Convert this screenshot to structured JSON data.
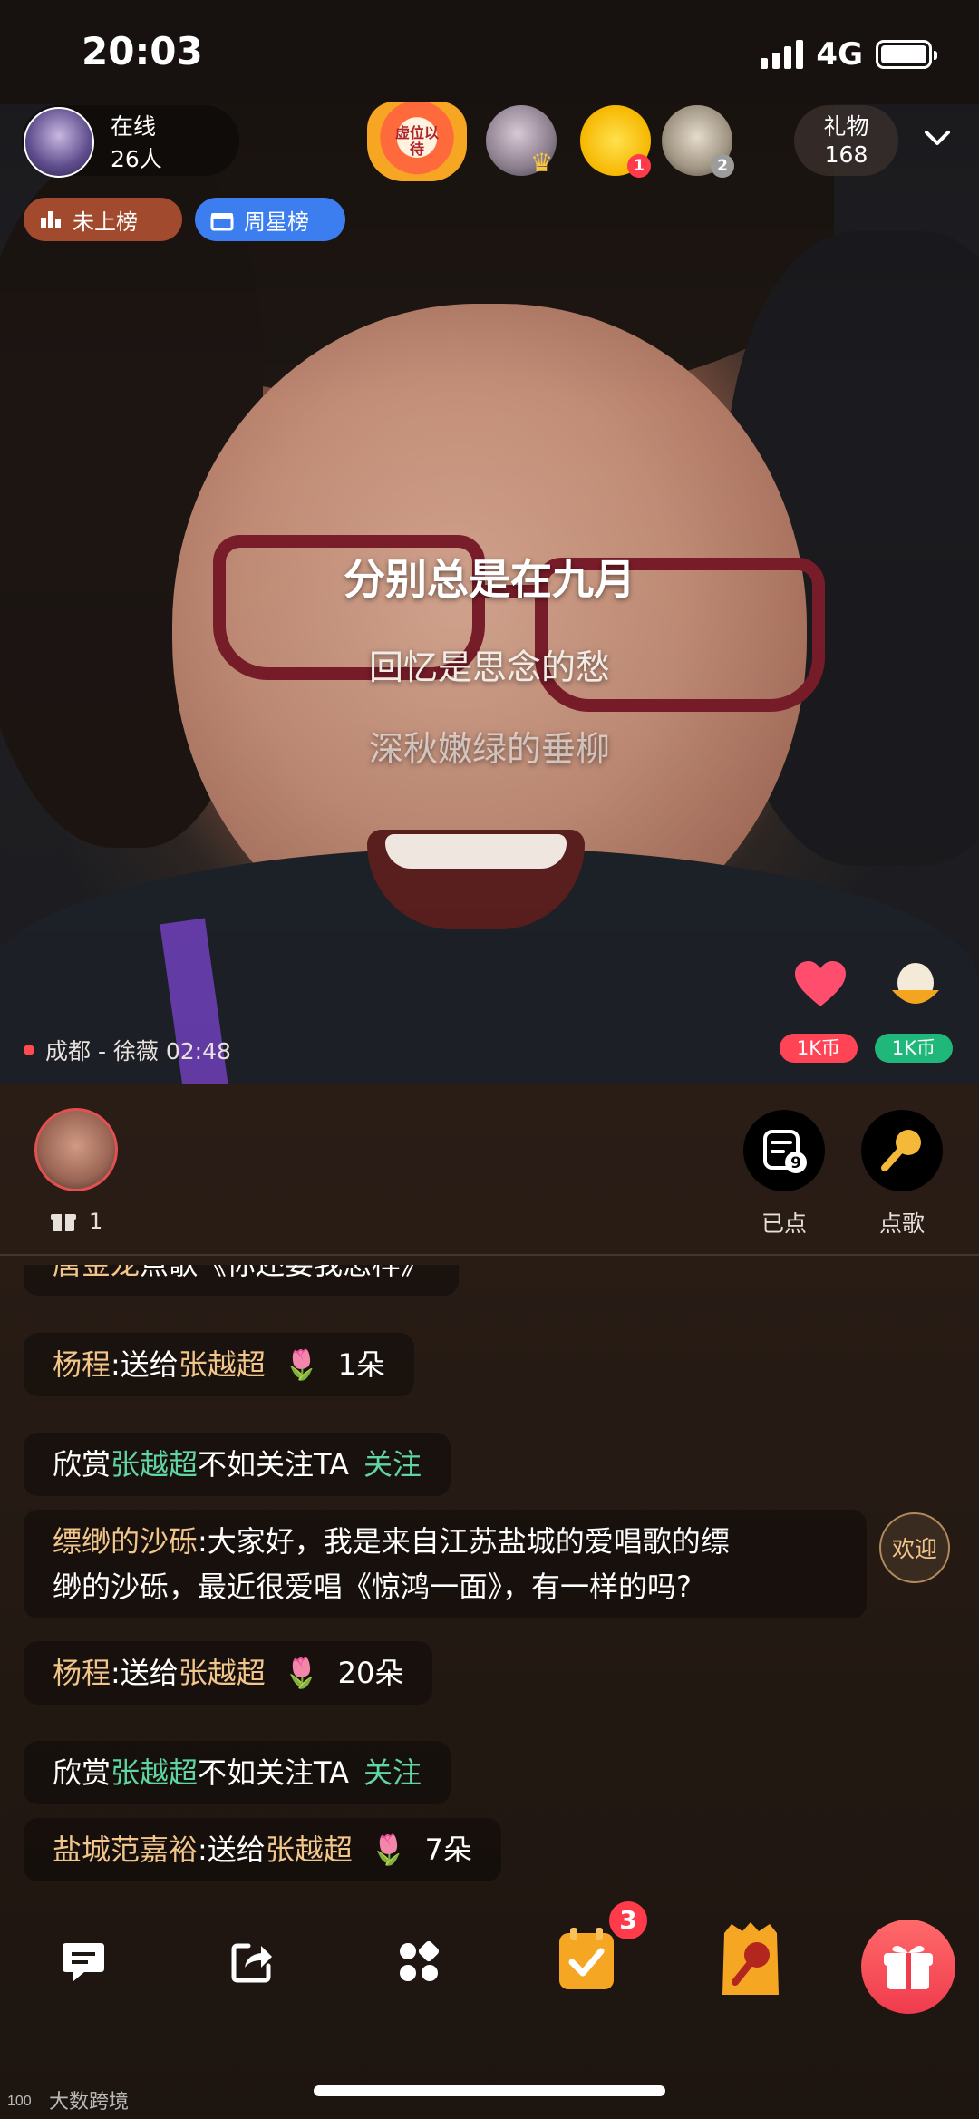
{
  "status": {
    "time": "20:03",
    "network": "4G"
  },
  "header": {
    "online_label": "在线",
    "online_count": "26人",
    "rank_badge_text": "虚位以待",
    "fan_badges": [
      "1",
      "2"
    ],
    "gift_label": "礼物",
    "gift_count": "168"
  },
  "tags": {
    "not_ranked": "未上榜",
    "weekly_star": "周星榜"
  },
  "lyrics": [
    "分别总是在九月",
    "回忆是思念的愁",
    "深秋嫩绿的垂柳"
  ],
  "live": {
    "location": "成都 - 徐薇 02:48"
  },
  "coin_gifts": [
    {
      "icon": "heart-icon",
      "label": "1K币",
      "color": "#ff4456"
    },
    {
      "icon": "egg-icon",
      "label": "1K币",
      "color": "#1fb87a"
    }
  ],
  "singer": {
    "gift_count": "1"
  },
  "actions": {
    "played_label": "已点",
    "played_count": "9",
    "request_label": "点歌"
  },
  "chat": {
    "m0": {
      "user": "唐金龙",
      "text": "点歌《你还要我怎样》"
    },
    "m1": {
      "user": "杨程",
      "mid": ":送给",
      "target": "张越超",
      "count": "1朵"
    },
    "m2": {
      "pre": "欣赏",
      "target": "张越超",
      "post": "不如关注TA",
      "follow": "关注"
    },
    "m3": {
      "user": "缥缈的沙砾",
      "line1": ":大家好，我是来自江苏盐城的爱唱歌的缥",
      "line2": "缈的沙砾，最近很爱唱《惊鸿一面》，有一样的吗?"
    },
    "m4": {
      "user": "杨程",
      "mid": ":送给",
      "target": "张越超",
      "count": "20朵"
    },
    "m5": {
      "pre": "欣赏",
      "target": "张越超",
      "post": "不如关注TA",
      "follow": "关注"
    },
    "m6": {
      "user": "盐城范嘉裕",
      "mid": ":送给",
      "target": "张越超",
      "count": "7朵"
    },
    "welcome": "欢迎"
  },
  "bottom": {
    "task_badge": "3"
  },
  "watermark": "大数跨境",
  "colors": {
    "accent_gold": "#f2c58a",
    "accent_green": "#5fd5a2",
    "live_red": "#ff4b4b"
  }
}
